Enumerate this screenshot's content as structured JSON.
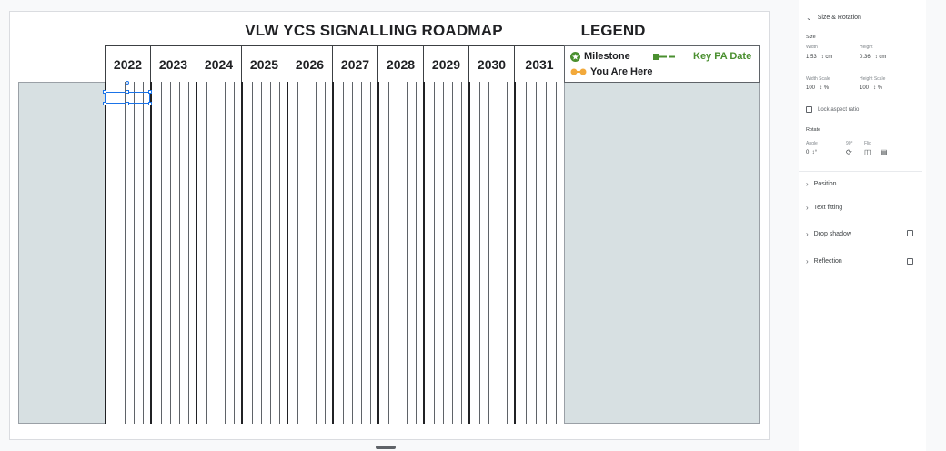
{
  "slide": {
    "title": "VLW YCS SIGNALLING ROADMAP",
    "legend_title": "LEGEND",
    "years": [
      "2022",
      "2023",
      "2024",
      "2025",
      "2026",
      "2027",
      "2028",
      "2029",
      "2030",
      "2031"
    ],
    "legend": {
      "milestone": "Milestone",
      "key_pa_date": "Key PA Date",
      "you_are_here": "You Are Here"
    }
  },
  "sidebar": {
    "size_rotation": "Size & Rotation",
    "size": "Size",
    "width_label": "Width",
    "height_label": "Height",
    "width_value": "1.53",
    "height_value": "0.36",
    "unit_cm": "cm",
    "width_scale_label": "Width Scale",
    "height_scale_label": "Height Scale",
    "width_scale_value": "100",
    "height_scale_value": "100",
    "unit_pct": "%",
    "lock_aspect": "Lock aspect ratio",
    "rotate": "Rotate",
    "angle_label": "Angle",
    "angle_value": "0",
    "unit_deg": "°",
    "rotate90_label": "90°",
    "flip_label": "Flip",
    "position": "Position",
    "text_fitting": "Text fitting",
    "drop_shadow": "Drop shadow",
    "reflection": "Reflection"
  },
  "colors": {
    "panel_fill": "#d7e0e2",
    "milestone_green": "#4a8f2f",
    "you_are_here_orange": "#f2a93b",
    "selection_blue": "#1a73e8"
  }
}
